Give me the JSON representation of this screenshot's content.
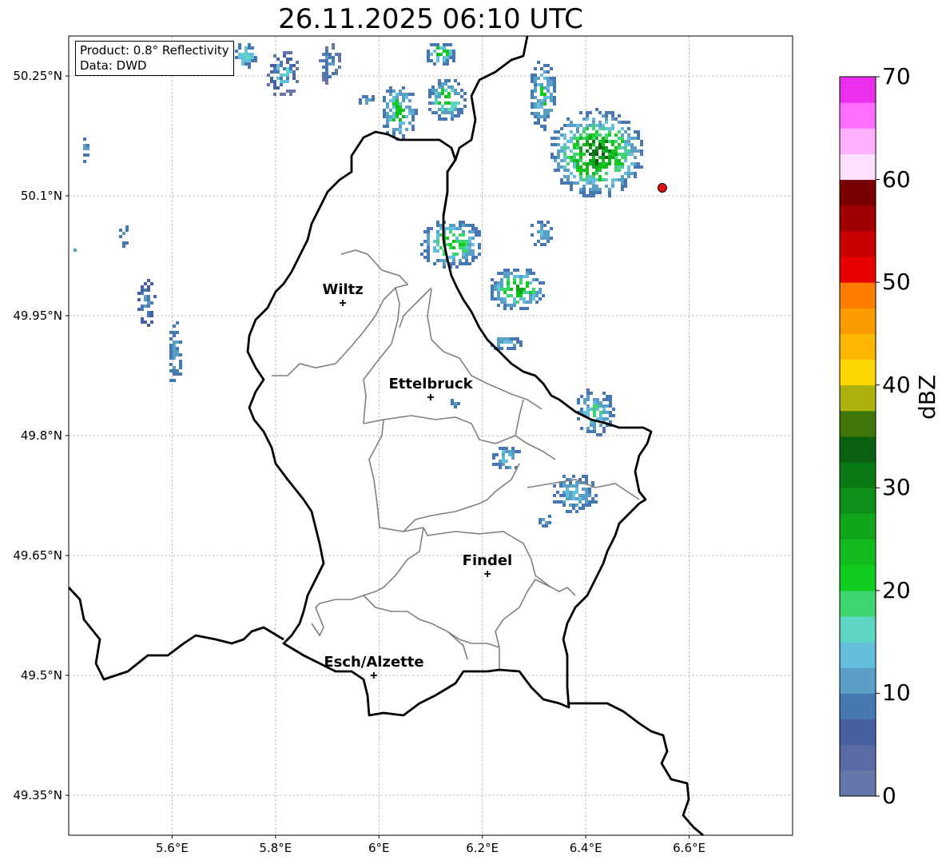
{
  "title": "26.11.2025 06:10 UTC",
  "info": {
    "product": "Product: 0.8° Reflectivity",
    "data": "Data: DWD"
  },
  "map": {
    "lon_range": [
      5.4,
      6.8
    ],
    "lat_range": [
      49.3,
      50.3
    ],
    "lat_ticks": [
      {
        "value": 50.25,
        "label": "50.25°N"
      },
      {
        "value": 50.1,
        "label": "50.1°N"
      },
      {
        "value": 49.95,
        "label": "49.95°N"
      },
      {
        "value": 49.8,
        "label": "49.8°N"
      },
      {
        "value": 49.65,
        "label": "49.65°N"
      },
      {
        "value": 49.5,
        "label": "49.5°N"
      },
      {
        "value": 49.35,
        "label": "49.35°N"
      }
    ],
    "lon_ticks": [
      {
        "value": 5.6,
        "label": "5.6°E"
      },
      {
        "value": 5.8,
        "label": "5.8°E"
      },
      {
        "value": 6.0,
        "label": "6°E"
      },
      {
        "value": 6.2,
        "label": "6.2°E"
      },
      {
        "value": 6.4,
        "label": "6.4°E"
      },
      {
        "value": 6.6,
        "label": "6.6°E"
      }
    ],
    "grid": true,
    "cities": [
      {
        "name": "Wiltz",
        "lon": 5.93,
        "lat": 49.966
      },
      {
        "name": "Ettelbruck",
        "lon": 6.1,
        "lat": 49.848
      },
      {
        "name": "Findel",
        "lon": 6.21,
        "lat": 49.627
      },
      {
        "name": "Esch/Alzette",
        "lon": 5.99,
        "lat": 49.5
      }
    ],
    "radar_site": {
      "lon": 6.548,
      "lat": 50.11,
      "color": "#e01010"
    }
  },
  "colorbar": {
    "label": "dBZ",
    "min": 0,
    "max": 70,
    "step": 2.5,
    "ticks": [
      "0",
      "10",
      "20",
      "30",
      "40",
      "50",
      "60",
      "70"
    ],
    "colors": [
      "#6577a8",
      "#5a6aa4",
      "#4760a2",
      "#4878b2",
      "#599fc6",
      "#64bfdc",
      "#5ed6c4",
      "#3dd56e",
      "#10cc1c",
      "#12bb1c",
      "#10a61c",
      "#0f9018",
      "#0c7a14",
      "#0a6010",
      "#3f760c",
      "#aab10c",
      "#fdd800",
      "#fcb800",
      "#fc9c00",
      "#fe7d00",
      "#e60000",
      "#c80000",
      "#a00000",
      "#780000",
      "#ffdffe",
      "#ffb0ff",
      "#ff6eff",
      "#ea2fee"
    ]
  }
}
